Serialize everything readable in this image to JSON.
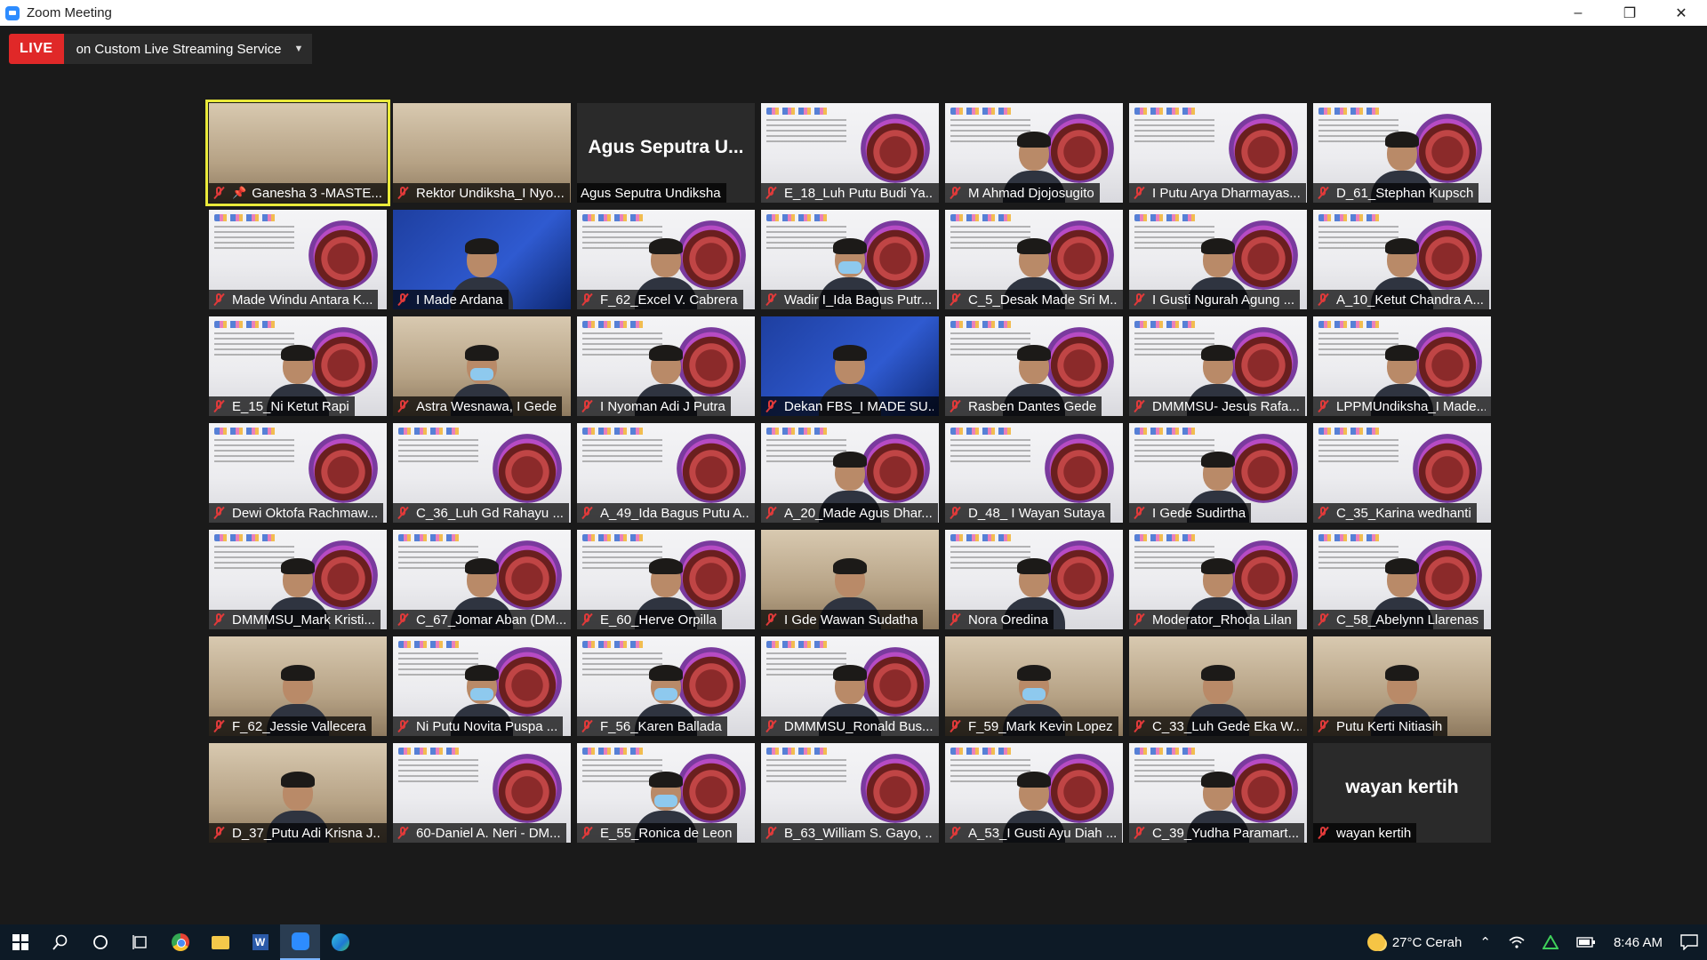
{
  "window": {
    "title": "Zoom Meeting",
    "controls": {
      "minimize": "–",
      "restore": "❐",
      "close": "✕"
    }
  },
  "live": {
    "badge": "LIVE",
    "service": "on Custom Live Streaming Service",
    "badge_color": "#e02828"
  },
  "participants": [
    {
      "name": "Ganesha 3 -MASTE...",
      "style": "photo",
      "active": true,
      "pinned": true
    },
    {
      "name": "Rektor Undiksha_I Nyo...",
      "style": "photo"
    },
    {
      "name": "Agus Seputra Undiksha",
      "style": "dark",
      "big_name": "Agus Seputra U...",
      "mic_on": true
    },
    {
      "name": "E_18_Luh Putu Budi Ya...",
      "style": "bg"
    },
    {
      "name": "M Ahmad Djojosugito",
      "style": "bg",
      "person": true
    },
    {
      "name": "I Putu Arya Dharmayas...",
      "style": "bg"
    },
    {
      "name": "D_61_Stephan Kupsch",
      "style": "bg",
      "person": true
    },
    {
      "name": "Made Windu Antara K...",
      "style": "bg"
    },
    {
      "name": "I Made Ardana",
      "style": "blue",
      "person": true
    },
    {
      "name": "F_62_Excel V. Cabrera",
      "style": "bg",
      "person": true
    },
    {
      "name": "Wadir I_Ida Bagus Putr...",
      "style": "bg",
      "person": true,
      "mask": true
    },
    {
      "name": "C_5_Desak Made Sri M...",
      "style": "bg",
      "person": true
    },
    {
      "name": "I Gusti Ngurah Agung ...",
      "style": "bg",
      "person": true
    },
    {
      "name": "A_10_Ketut Chandra A...",
      "style": "bg",
      "person": true
    },
    {
      "name": "E_15_Ni Ketut Rapi",
      "style": "bg",
      "person": true
    },
    {
      "name": "Astra Wesnawa, I Gede",
      "style": "photo",
      "person": true,
      "mask": true
    },
    {
      "name": "I Nyoman Adi J Putra",
      "style": "bg",
      "person": true
    },
    {
      "name": "Dekan FBS_I MADE SU...",
      "style": "blue",
      "person": true
    },
    {
      "name": "Rasben Dantes Gede",
      "style": "bg",
      "person": true
    },
    {
      "name": "DMMMSU- Jesus Rafa...",
      "style": "bg",
      "person": true
    },
    {
      "name": "LPPMUndiksha_I Made...",
      "style": "bg",
      "person": true
    },
    {
      "name": "Dewi Oktofa Rachmaw...",
      "style": "bg"
    },
    {
      "name": "C_36_Luh Gd Rahayu ...",
      "style": "bg"
    },
    {
      "name": "A_49_Ida Bagus Putu A...",
      "style": "bg"
    },
    {
      "name": "A_20_Made Agus Dhar...",
      "style": "bg",
      "person": true
    },
    {
      "name": "D_48_ I Wayan Sutaya",
      "style": "bg"
    },
    {
      "name": "I Gede Sudirtha",
      "style": "bg",
      "person": true
    },
    {
      "name": "C_35_Karina wedhanti",
      "style": "bg"
    },
    {
      "name": "DMMMSU_Mark Kristi...",
      "style": "bg",
      "person": true
    },
    {
      "name": "C_67_Jomar Aban (DM...",
      "style": "bg",
      "person": true
    },
    {
      "name": "E_60_Herve Orpilla",
      "style": "bg",
      "person": true
    },
    {
      "name": "I Gde Wawan Sudatha",
      "style": "photo",
      "person": true
    },
    {
      "name": "Nora Oredina",
      "style": "bg",
      "person": true
    },
    {
      "name": "Moderator_Rhoda Lilan",
      "style": "bg",
      "person": true
    },
    {
      "name": "C_58_Abelynn Llarenas",
      "style": "bg",
      "person": true
    },
    {
      "name": "F_62_Jessie Vallecera",
      "style": "photo",
      "person": true
    },
    {
      "name": "Ni Putu Novita Puspa ...",
      "style": "bg",
      "person": true,
      "mask": true
    },
    {
      "name": "F_56_Karen Ballada",
      "style": "bg",
      "person": true,
      "mask": true
    },
    {
      "name": "DMMMSU_Ronald Bus...",
      "style": "bg",
      "person": true
    },
    {
      "name": "F_59_Mark Kevin Lopez",
      "style": "photo",
      "person": true,
      "mask": true
    },
    {
      "name": "C_33_Luh Gede Eka W...",
      "style": "photo",
      "person": true
    },
    {
      "name": "Putu Kerti Nitiasih",
      "style": "photo",
      "person": true
    },
    {
      "name": "D_37_Putu Adi Krisna J...",
      "style": "photo",
      "person": true
    },
    {
      "name": "60-Daniel A. Neri - DM...",
      "style": "bg"
    },
    {
      "name": "E_55_Ronica de Leon",
      "style": "bg",
      "person": true,
      "mask": true
    },
    {
      "name": "B_63_William S. Gayo, ...",
      "style": "bg"
    },
    {
      "name": "A_53_I Gusti Ayu Diah ...",
      "style": "bg",
      "person": true
    },
    {
      "name": "C_39_Yudha Paramart...",
      "style": "bg",
      "person": true
    },
    {
      "name": "wayan kertih",
      "style": "dark",
      "big_name": "wayan kertih"
    }
  ],
  "taskbar": {
    "weather": "27°C  Cerah",
    "time": "8:46 AM"
  }
}
